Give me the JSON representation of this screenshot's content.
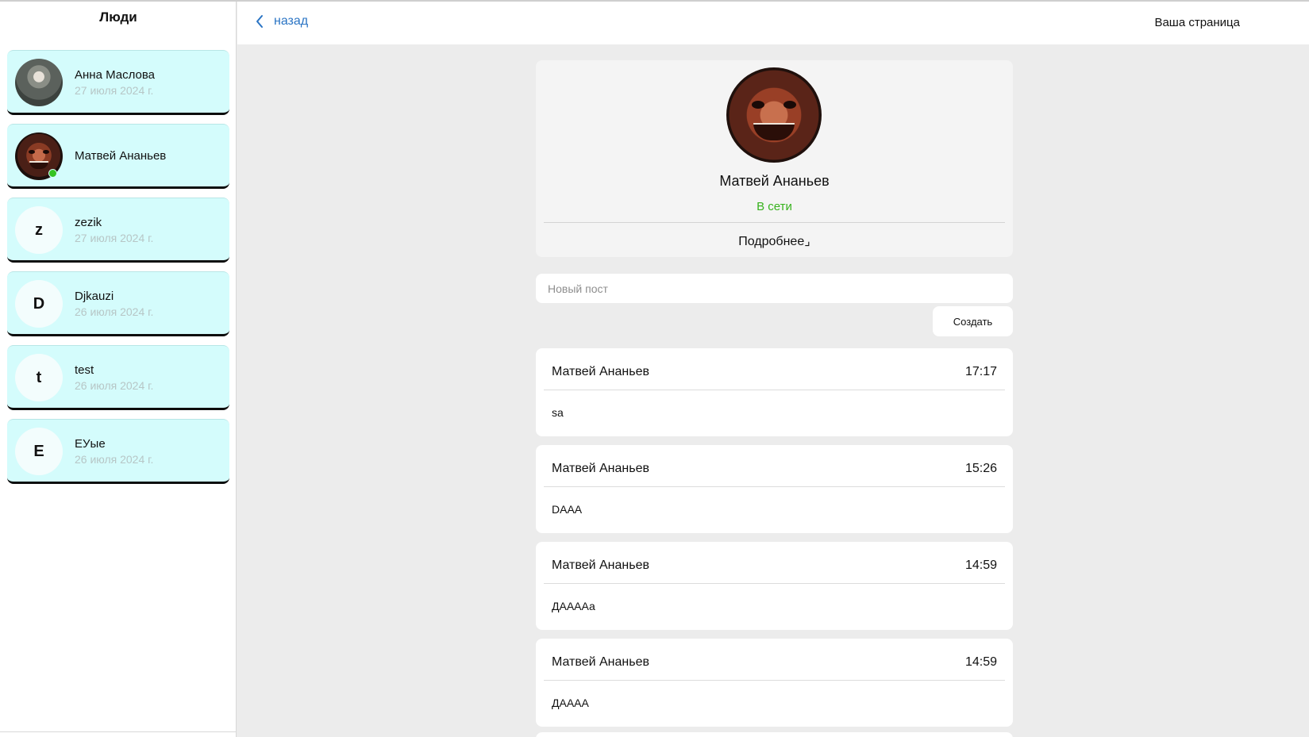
{
  "sidebar": {
    "title": "Люди",
    "people": [
      {
        "name": "Анна Маслова",
        "date": "27 июля 2024 г.",
        "avatar": "photo",
        "online": false
      },
      {
        "name": "Матвей Ананьев",
        "date": "",
        "avatar": "photo",
        "online": true
      },
      {
        "name": "zezik",
        "date": "27 июля 2024 г.",
        "avatar": "z",
        "online": false
      },
      {
        "name": "Djkauzi",
        "date": "26 июля 2024 г.",
        "avatar": "D",
        "online": false
      },
      {
        "name": "test",
        "date": "26 июля 2024 г.",
        "avatar": "t",
        "online": false
      },
      {
        "name": "EУые",
        "date": "26 июля 2024 г.",
        "avatar": "E",
        "online": false
      }
    ]
  },
  "header": {
    "back_label": "назад",
    "your_page_label": "Ваша страница"
  },
  "profile": {
    "name": "Матвей Ананьев",
    "status": "В сети",
    "more_label": "Подробнее⌟"
  },
  "new_post": {
    "placeholder": "Новый пост",
    "value": "",
    "create_label": "Создать"
  },
  "posts": [
    {
      "author": "Матвей Ананьев",
      "time": "17:17",
      "text": "sa"
    },
    {
      "author": "Матвей Ананьев",
      "time": "15:26",
      "text": "DAAA"
    },
    {
      "author": "Матвей Ананьев",
      "time": "14:59",
      "text": "ДААААа"
    },
    {
      "author": "Матвей Ананьев",
      "time": "14:59",
      "text": "ДАААА"
    }
  ],
  "colors": {
    "card_bg": "#d4fcfc",
    "link": "#2a74c4",
    "online": "#37b21d",
    "page_bg": "#ececec"
  }
}
